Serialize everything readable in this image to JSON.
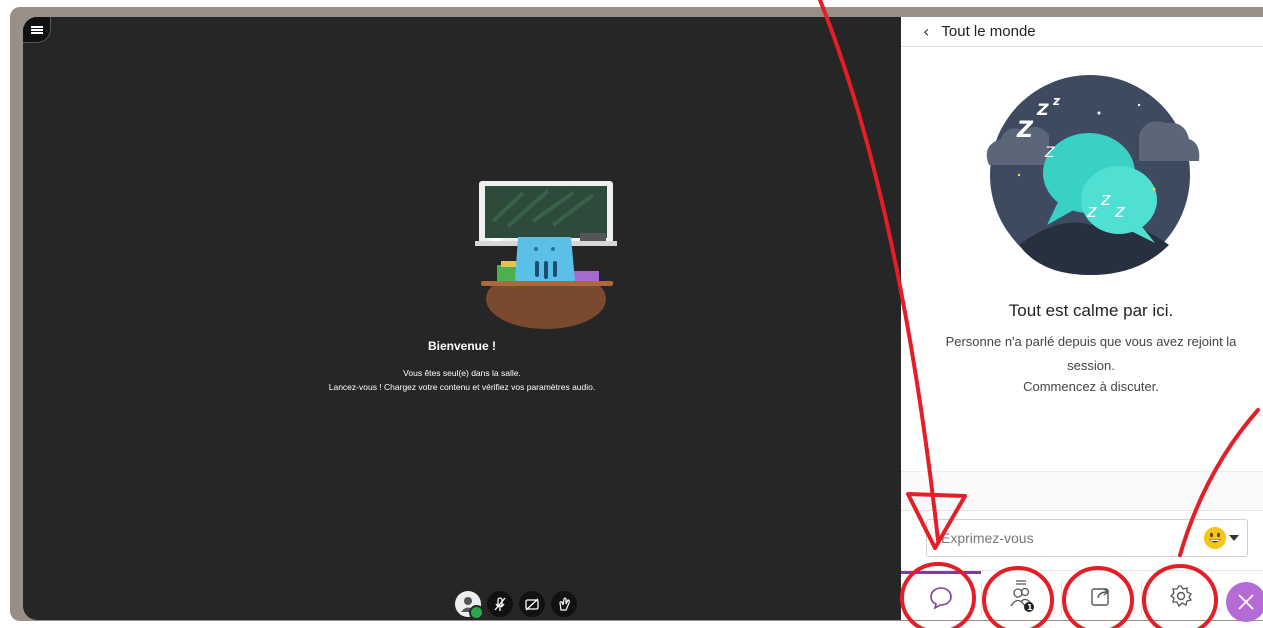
{
  "stage": {
    "welcome_title": "Bienvenue !",
    "welcome_line1": "Vous êtes seul(e) dans la salle.",
    "welcome_line2": "Lancez-vous ! Chargez votre contenu et vérifiez vos paramètres audio."
  },
  "media_controls": [
    {
      "name": "avatar-status",
      "icon": "user-avatar-icon"
    },
    {
      "name": "microphone",
      "icon": "mic-off-icon"
    },
    {
      "name": "camera",
      "icon": "camera-off-icon"
    },
    {
      "name": "raise-hand",
      "icon": "hand-icon"
    }
  ],
  "chat": {
    "header_title": "Tout le monde",
    "empty_title": "Tout est calme par ici.",
    "empty_line1": "Personne n'a parlé depuis que vous avez rejoint la",
    "empty_line2": "session.",
    "empty_line3": "Commencez à discuter.",
    "placeholder": "Exprimez-vous",
    "input_value": ""
  },
  "tabs": [
    {
      "name": "chat",
      "icon": "chat-bubble-icon",
      "active": true
    },
    {
      "name": "participants",
      "icon": "participants-icon",
      "badge": "1"
    },
    {
      "name": "share-content",
      "icon": "share-icon"
    },
    {
      "name": "settings",
      "icon": "gear-icon"
    },
    {
      "name": "leave",
      "icon": "close-icon"
    }
  ],
  "colors": {
    "stage_bg": "#262626",
    "frame": "#9a8f87",
    "accent": "#7b3fa0",
    "leave": "#b46bd6",
    "annotation": "#e41e26"
  }
}
